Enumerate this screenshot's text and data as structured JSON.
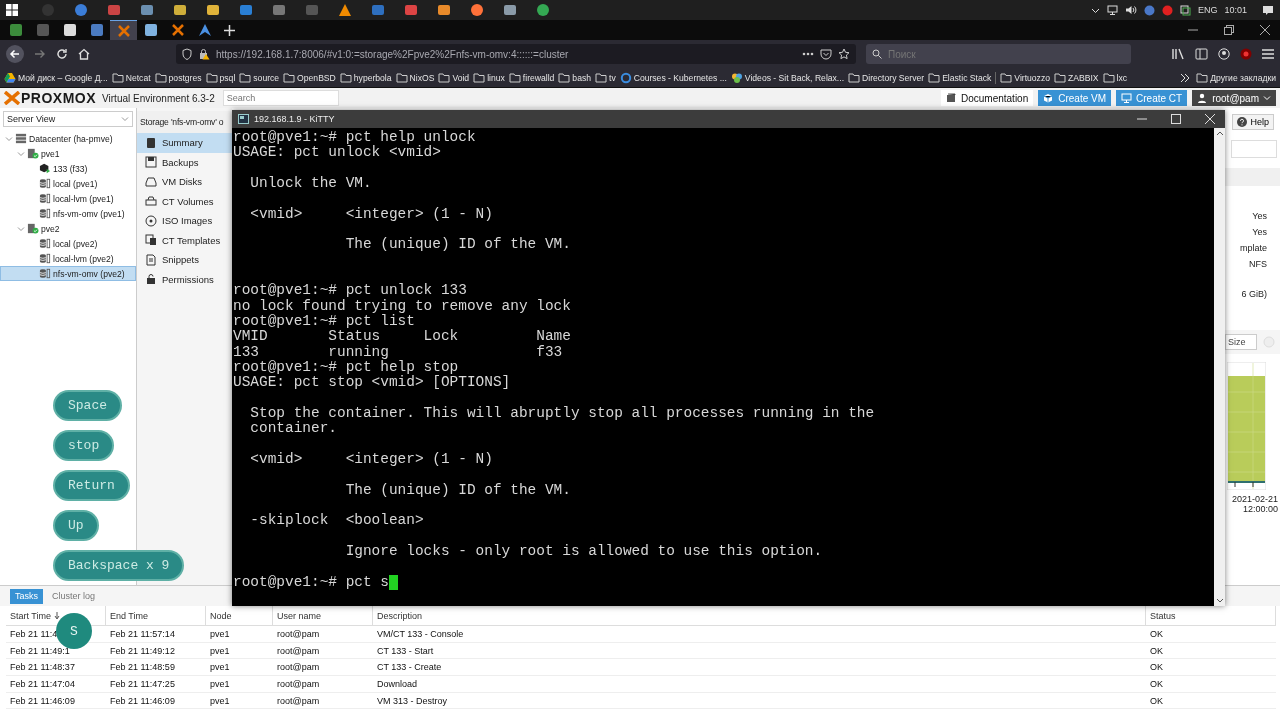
{
  "taskbar": {
    "language": "ENG",
    "clock": "10:01"
  },
  "browser": {
    "tabs": [
      {
        "selected": false
      },
      {
        "selected": false
      },
      {
        "selected": false
      },
      {
        "selected": false
      },
      {
        "selected": true
      },
      {
        "selected": false
      },
      {
        "selected": false
      },
      {
        "selected": false
      }
    ],
    "url": "https://192.168.1.7:8006/#v1:0:=storage%2Fpve2%2Fnfs-vm-omv:4::::::=cluster",
    "search_placeholder": "Поиск",
    "bookmarks": [
      {
        "label": "Мой диск – Google Д...",
        "kind": "drive"
      },
      {
        "label": "Netcat",
        "kind": "folder"
      },
      {
        "label": "postgres",
        "kind": "folder"
      },
      {
        "label": "psql",
        "kind": "folder"
      },
      {
        "label": "source",
        "kind": "folder"
      },
      {
        "label": "OpenBSD",
        "kind": "folder"
      },
      {
        "label": "hyperbola",
        "kind": "folder"
      },
      {
        "label": "NixOS",
        "kind": "folder"
      },
      {
        "label": "Void",
        "kind": "folder"
      },
      {
        "label": "linux",
        "kind": "folder"
      },
      {
        "label": "firewalld",
        "kind": "folder"
      },
      {
        "label": "bash",
        "kind": "folder"
      },
      {
        "label": "tv",
        "kind": "folder"
      },
      {
        "label": "Courses - Kubernetes ...",
        "kind": "ring"
      },
      {
        "label": "Videos - Sit Back, Relax...",
        "kind": "flower"
      },
      {
        "label": "Directory Server",
        "kind": "folder"
      },
      {
        "label": "Elastic Stack",
        "kind": "folder"
      },
      {
        "label": "Virtuozzo",
        "kind": "folder"
      },
      {
        "label": "ZABBIX",
        "kind": "folder"
      },
      {
        "label": "lxc",
        "kind": "folder"
      }
    ],
    "other_bookmarks": "Другие закладки"
  },
  "proxmox": {
    "logo": "PROXMOX",
    "version": "Virtual Environment 6.3-2",
    "search_placeholder": "Search",
    "header_buttons": [
      {
        "label": "Documentation",
        "kind": "plain"
      },
      {
        "label": "Create VM",
        "kind": "primary"
      },
      {
        "label": "Create CT",
        "kind": "primary"
      },
      {
        "label": "root@pam",
        "kind": "user"
      }
    ],
    "view_selector": "Server View",
    "tree": [
      {
        "label": "Datacenter (ha-pmve)",
        "kind": "datacenter",
        "selected": false,
        "expanded": true,
        "children": [
          {
            "label": "pve1",
            "kind": "node",
            "selected": false,
            "expanded": true,
            "children": [
              {
                "label": "133 (f33)",
                "kind": "container",
                "selected": false
              },
              {
                "label": "local (pve1)",
                "kind": "storage",
                "selected": false
              },
              {
                "label": "local-lvm (pve1)",
                "kind": "storage",
                "selected": false
              },
              {
                "label": "nfs-vm-omv (pve1)",
                "kind": "storage",
                "selected": false
              }
            ]
          },
          {
            "label": "pve2",
            "kind": "node",
            "selected": false,
            "expanded": true,
            "children": [
              {
                "label": "local (pve2)",
                "kind": "storage",
                "selected": false
              },
              {
                "label": "local-lvm (pve2)",
                "kind": "storage",
                "selected": false
              },
              {
                "label": "nfs-vm-omv (pve2)",
                "kind": "storage",
                "selected": true
              }
            ]
          }
        ]
      }
    ],
    "panel_title": "Storage 'nfs-vm-omv' o",
    "nav": [
      {
        "label": "Summary",
        "selected": true
      },
      {
        "label": "Backups",
        "selected": false
      },
      {
        "label": "VM Disks",
        "selected": false
      },
      {
        "label": "CT Volumes",
        "selected": false
      },
      {
        "label": "ISO Images",
        "selected": false
      },
      {
        "label": "CT Templates",
        "selected": false
      },
      {
        "label": "Snippets",
        "selected": false
      },
      {
        "label": "Permissions",
        "selected": false
      }
    ],
    "help_button": "Help",
    "details": [
      "Yes",
      "Yes",
      "mplate",
      "NFS",
      "6 GiB)"
    ],
    "size_field": "Size",
    "graph_time": [
      "2021-02-21",
      "12:00:00"
    ],
    "tasks": {
      "tabs": [
        {
          "label": "Tasks",
          "selected": true
        },
        {
          "label": "Cluster log",
          "selected": false
        }
      ],
      "columns": [
        "Start Time",
        "End Time",
        "Node",
        "User name",
        "Description",
        "Status"
      ],
      "rows": [
        [
          "Feb 21 11:4",
          "Feb 21 11:57:14",
          "pve1",
          "root@pam",
          "VM/CT 133 - Console",
          "OK"
        ],
        [
          "Feb 21 11:49:1",
          "Feb 21 11:49:12",
          "pve1",
          "root@pam",
          "CT 133 - Start",
          "OK"
        ],
        [
          "Feb 21 11:48:37",
          "Feb 21 11:48:59",
          "pve1",
          "root@pam",
          "CT 133 - Create",
          "OK"
        ],
        [
          "Feb 21 11:47:04",
          "Feb 21 11:47:25",
          "pve1",
          "root@pam",
          "Download",
          "OK"
        ],
        [
          "Feb 21 11:46:09",
          "Feb 21 11:46:09",
          "pve1",
          "root@pam",
          "VM 313 - Destroy",
          "OK"
        ]
      ]
    }
  },
  "terminal": {
    "title": "192.168.1.9 - KiTTY",
    "scrollback": "root@pve1:~# pct help unlock\nUSAGE: pct unlock <vmid>\n\n  Unlock the VM.\n\n  <vmid>     <integer> (1 - N)\n\n             The (unique) ID of the VM.\n\n\nroot@pve1:~# pct unlock 133\nno lock found trying to remove any lock\nroot@pve1:~# pct list\nVMID       Status     Lock         Name\n133        running                 f33\nroot@pve1:~# pct help stop\nUSAGE: pct stop <vmid> [OPTIONS]\n\n  Stop the container. This will abruptly stop all processes running in the\n  container.\n\n  <vmid>     <integer> (1 - N)\n\n             The (unique) ID of the VM.\n\n  -skiplock  <boolean>\n\n             Ignore locks - only root is allowed to use this option.\n\n",
    "prompt": "root@pve1:~# pct s"
  },
  "keystrokes": [
    {
      "label": "Space",
      "kind": "pill"
    },
    {
      "label": "stop",
      "kind": "pill"
    },
    {
      "label": "Return",
      "kind": "pill"
    },
    {
      "label": "Up",
      "kind": "pill"
    },
    {
      "label": "Backspace x 9",
      "kind": "pill"
    },
    {
      "label": "S",
      "kind": "circle"
    }
  ]
}
